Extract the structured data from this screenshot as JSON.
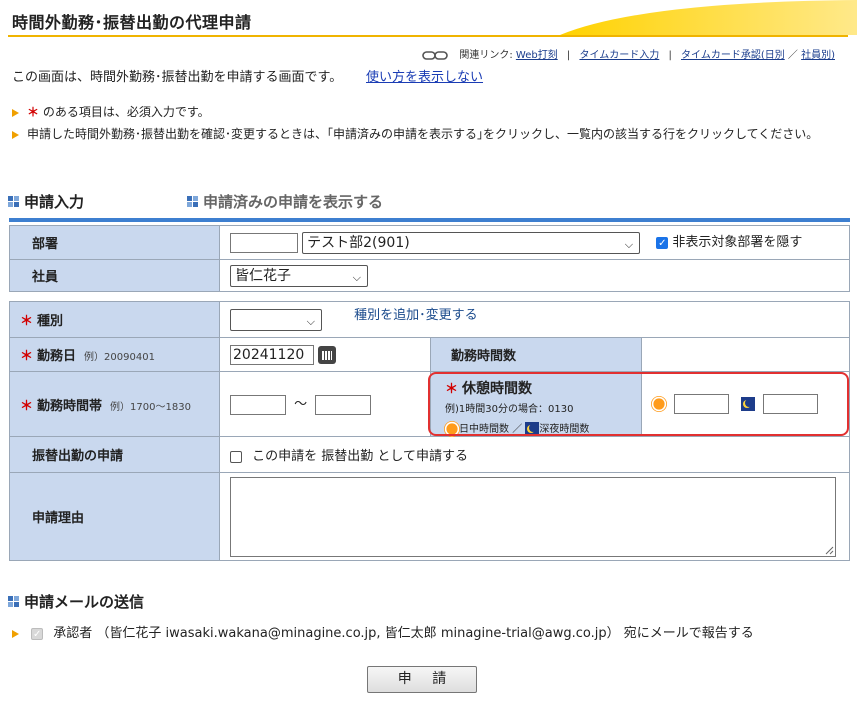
{
  "header": {
    "title": "時間外勤務･振替出勤の代理申請",
    "related_label": "関連リンク:",
    "related_links": [
      "Web打刻",
      "タイムカード入力",
      "タイムカード承認(日別",
      "社員別)"
    ],
    "slash": "／",
    "pipe": "|"
  },
  "intro": {
    "text": "この画面は、時間外勤務･振替出勤を申請する画面です。",
    "toggle_link": "使い方を表示しない"
  },
  "notes": {
    "required_star": "＊",
    "required_text": "のある項目は、必須入力です。",
    "confirm_text": "申請した時間外勤務･振替出勤を確認･変更するときは、｢申請済みの申請を表示する｣をクリックし、一覧内の該当する行をクリックしてください。"
  },
  "tabs": {
    "input": "申請入力",
    "show_applied": "申請済みの申請を表示する"
  },
  "form": {
    "dept_label": "部署",
    "dept_code": "",
    "dept_selected": "テスト部2(901)",
    "hide_dept_label": "非表示対象部署を隠す",
    "hide_dept_checked": true,
    "employee_label": "社員",
    "employee_selected": "皆仁花子",
    "kind_label": "種別",
    "kind_selected": "",
    "kind_link": "種別を追加･変更する",
    "workdate_label": "勤務日",
    "workdate_example": "例）20090401",
    "workdate_value": "20241120",
    "workhours_label": "勤務時間数",
    "workhours_value": "",
    "workrange_label": "勤務時間帯",
    "workrange_example": "例）1700～1830",
    "range_from": "",
    "range_sep": "～",
    "range_to": "",
    "break_label": "休憩時間数",
    "break_example": "例)1時間30分の場合：0130",
    "break_day_label": "日中時間数",
    "break_night_label": "深夜時間数",
    "break_sep": "／",
    "break_day_value": "",
    "break_night_value": "",
    "substitute_label": "振替出勤の申請",
    "substitute_checkbox_text": "この申請を 振替出勤 として申請する",
    "substitute_checked": false,
    "reason_label": "申請理由",
    "reason_value": ""
  },
  "mail": {
    "section_title": "申請メールの送信",
    "recipient_text": "承認者 （皆仁花子 iwasaki.wakana@minagine.co.jp, 皆仁太郎 minagine-trial@awg.co.jp） 宛にメールで報告する",
    "checked": true
  },
  "submit_label": "申 請",
  "colors": {
    "accent_yellow": "#f0b400",
    "label_bg": "#c9d8ee",
    "tab_line": "#3d7fd0",
    "required_red": "#d20000",
    "highlight_red": "#e23030"
  }
}
